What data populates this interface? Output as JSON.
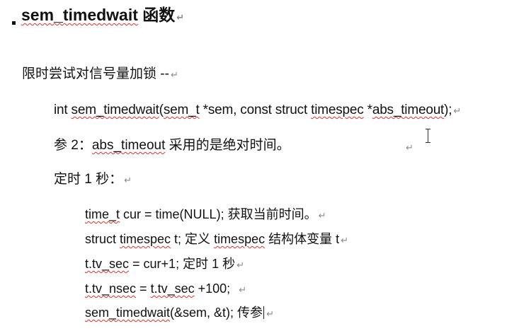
{
  "title": {
    "fn_name": "sem_timedwait",
    "suffix": " 函数"
  },
  "intro": "限时尝试对信号量加锁 --",
  "signature": {
    "p1": "int ",
    "sem_timedwait": "sem_timedwait",
    "p2": "(",
    "sem_t": "sem_t",
    "p3": " *sem, const struct ",
    "timespec": "timespec",
    "p4": " *",
    "abs_timeout": "abs_timeout",
    "p5": ");"
  },
  "param_note": {
    "prefix": "参 2：",
    "abs_timeout": "abs_timeout",
    "suffix": " 采用的是绝对时间。"
  },
  "timer_heading": "定时 1 秒：",
  "code": {
    "line1": {
      "time_t": "time_t",
      "rest": " cur = time(NULL);  获取当前时间。"
    },
    "line2": {
      "p1": "struct ",
      "timespec": "timespec",
      "p2": " t;    定义 ",
      "timespec2": "timespec",
      "p3": " 结构体变量 t"
    },
    "line3": {
      "tv_sec": "t.tv_sec",
      "rest": " = cur+1;  定时 1 秒"
    },
    "line4": {
      "tv_nsec": "t.tv_nsec",
      "p1": " = ",
      "tv_sec": "t.tv_sec",
      "p2": " +100;"
    },
    "line5": {
      "fn": "sem_timedwait",
      "rest": "(&sem, &t);  传参"
    }
  },
  "paragraph_mark": "↵"
}
